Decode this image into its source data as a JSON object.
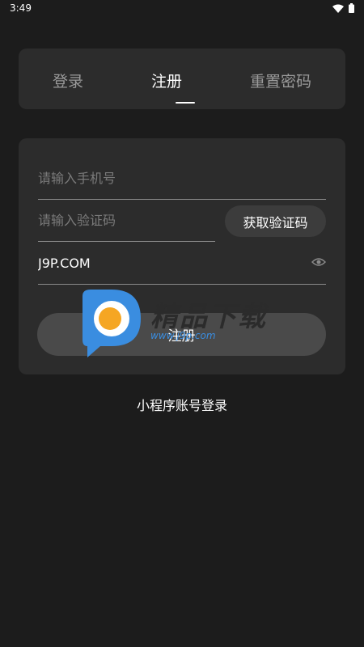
{
  "status_bar": {
    "time": "3:49"
  },
  "tabs": [
    {
      "label": "登录"
    },
    {
      "label": "注册"
    },
    {
      "label": "重置密码"
    }
  ],
  "active_tab": "注册",
  "form": {
    "phone": {
      "placeholder": "请输入手机号",
      "value": ""
    },
    "code": {
      "placeholder": "请输入验证码",
      "value": ""
    },
    "get_code_label": "获取验证码",
    "password": {
      "value": "J9P.COM"
    },
    "submit_label": "注册"
  },
  "mini_program_login": "小程序账号登录",
  "watermark": {
    "title": "精品下载",
    "url": "www.j9p.com"
  },
  "colors": {
    "background": "#1c1c1c",
    "card": "#2c2c2c",
    "accent_blue": "#3a8de0",
    "accent_orange": "#f5a623"
  }
}
